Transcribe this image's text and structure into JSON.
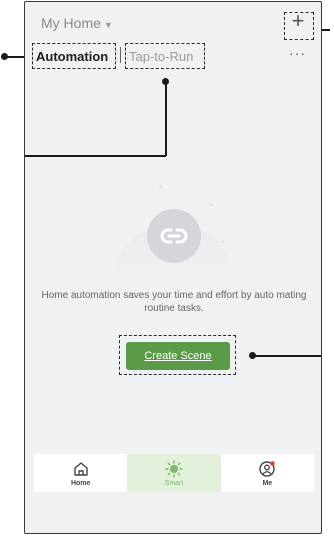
{
  "header": {
    "home_title": "My Home",
    "add_symbol": "+",
    "more_symbol": "···"
  },
  "tabs": {
    "automation": "Automation",
    "tap_to_run": "Tap-to-Run"
  },
  "empty_state": {
    "message": "Home automation saves your time and effort by auto mating routine tasks.",
    "create_button": "Create Scene"
  },
  "bottom_nav": {
    "home": "Home",
    "smart": "Smart",
    "me": "Me"
  },
  "colors": {
    "accent": "#5b9a47",
    "smart_bg": "#e3f1dc",
    "badge": "#e0433b"
  }
}
